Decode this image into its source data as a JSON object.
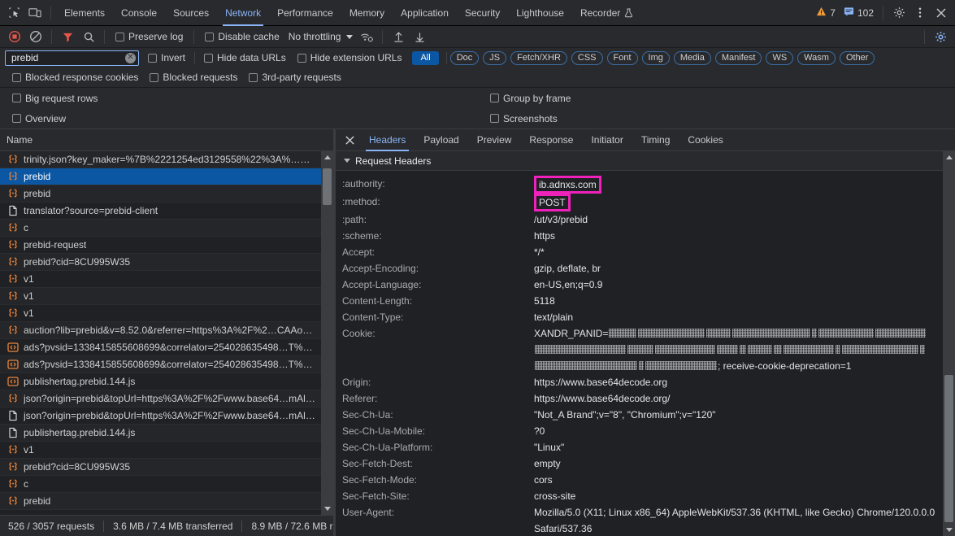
{
  "window": {
    "devtools_tabs": [
      {
        "label": "Elements",
        "active": false
      },
      {
        "label": "Console",
        "active": false
      },
      {
        "label": "Sources",
        "active": false
      },
      {
        "label": "Network",
        "active": true
      },
      {
        "label": "Performance",
        "active": false
      },
      {
        "label": "Memory",
        "active": false
      },
      {
        "label": "Application",
        "active": false
      },
      {
        "label": "Security",
        "active": false
      },
      {
        "label": "Lighthouse",
        "active": false
      },
      {
        "label": "Recorder",
        "active": false,
        "flask": true
      }
    ],
    "warnings_count": "7",
    "messages_count": "102"
  },
  "toolbar": {
    "throttling_label": "No throttling",
    "record_title": "Record",
    "clear_title": "Clear",
    "filter_title": "Filter",
    "search_title": "Search",
    "preserve_log": {
      "label": "Preserve log",
      "checked": false
    },
    "disable_cache": {
      "label": "Disable cache",
      "checked": false
    }
  },
  "filters": {
    "text_value": "prebid",
    "text_placeholder": "Filter",
    "invert": {
      "label": "Invert",
      "checked": false
    },
    "hide_data_urls": {
      "label": "Hide data URLs",
      "checked": false
    },
    "hide_extension_urls": {
      "label": "Hide extension URLs",
      "checked": false
    },
    "types": [
      {
        "label": "All",
        "selected": true
      },
      {
        "label": "Doc",
        "selected": false
      },
      {
        "label": "JS",
        "selected": false
      },
      {
        "label": "Fetch/XHR",
        "selected": false
      },
      {
        "label": "CSS",
        "selected": false
      },
      {
        "label": "Font",
        "selected": false
      },
      {
        "label": "Img",
        "selected": false
      },
      {
        "label": "Media",
        "selected": false
      },
      {
        "label": "Manifest",
        "selected": false
      },
      {
        "label": "WS",
        "selected": false
      },
      {
        "label": "Wasm",
        "selected": false
      },
      {
        "label": "Other",
        "selected": false
      }
    ],
    "blocked_response_cookies": {
      "label": "Blocked response cookies",
      "checked": false
    },
    "blocked_requests": {
      "label": "Blocked requests",
      "checked": false
    },
    "third_party_requests": {
      "label": "3rd-party requests",
      "checked": false
    }
  },
  "options": {
    "big_request_rows": {
      "label": "Big request rows",
      "checked": false
    },
    "group_by_frame": {
      "label": "Group by frame",
      "checked": false
    },
    "overview": {
      "label": "Overview",
      "checked": false
    },
    "screenshots": {
      "label": "Screenshots",
      "checked": false
    }
  },
  "request_list": {
    "column_header": "Name",
    "rows": [
      {
        "name": "trinity.json?key_maker=%7B%2221254ed3129558%22%3A%…%…",
        "icon": "json-icon",
        "selected": false
      },
      {
        "name": "prebid",
        "icon": "json-icon",
        "selected": true
      },
      {
        "name": "prebid",
        "icon": "json-icon",
        "selected": false
      },
      {
        "name": "translator?source=prebid-client",
        "icon": "document-icon",
        "selected": false
      },
      {
        "name": "c",
        "icon": "json-icon",
        "selected": false
      },
      {
        "name": "prebid-request",
        "icon": "json-icon",
        "selected": false
      },
      {
        "name": "prebid?cid=8CU995W35",
        "icon": "json-icon",
        "selected": false
      },
      {
        "name": "v1",
        "icon": "json-icon",
        "selected": false
      },
      {
        "name": "v1",
        "icon": "json-icon",
        "selected": false
      },
      {
        "name": "v1",
        "icon": "json-icon",
        "selected": false
      },
      {
        "name": "auction?lib=prebid&v=8.52.0&referrer=https%3A%2F%2…CAAoR…",
        "icon": "json-icon",
        "selected": false
      },
      {
        "name": "ads?pvsid=1338415855608699&correlator=254028635498…T%3…",
        "icon": "script-icon",
        "selected": false
      },
      {
        "name": "ads?pvsid=1338415855608699&correlator=254028635498…T%3…",
        "icon": "script-icon",
        "selected": false
      },
      {
        "name": "publishertag.prebid.144.js",
        "icon": "script-icon",
        "selected": false
      },
      {
        "name": "json?origin=prebid&topUrl=https%3A%2F%2Fwww.base64…mAll…",
        "icon": "json-icon",
        "selected": false
      },
      {
        "name": "json?origin=prebid&topUrl=https%3A%2F%2Fwww.base64…mAll…",
        "icon": "document-icon",
        "selected": false
      },
      {
        "name": "publishertag.prebid.144.js",
        "icon": "document-icon",
        "selected": false
      },
      {
        "name": "v1",
        "icon": "json-icon",
        "selected": false
      },
      {
        "name": "prebid?cid=8CU995W35",
        "icon": "json-icon",
        "selected": false
      },
      {
        "name": "c",
        "icon": "json-icon",
        "selected": false
      },
      {
        "name": "prebid",
        "icon": "json-icon",
        "selected": false
      }
    ]
  },
  "status_bar": {
    "requests": "526 / 3057 requests",
    "transferred": "3.6 MB / 7.4 MB transferred",
    "resources": "8.9 MB / 72.6 MB r"
  },
  "details": {
    "tabs": [
      {
        "label": "Headers",
        "active": true
      },
      {
        "label": "Payload",
        "active": false
      },
      {
        "label": "Preview",
        "active": false
      },
      {
        "label": "Response",
        "active": false
      },
      {
        "label": "Initiator",
        "active": false
      },
      {
        "label": "Timing",
        "active": false
      },
      {
        "label": "Cookies",
        "active": false
      }
    ],
    "section_title": "Request Headers",
    "headers": [
      {
        "name": ":authority:",
        "value": "ib.adnxs.com",
        "highlight": true
      },
      {
        "name": ":method:",
        "value": "POST",
        "highlight": true
      },
      {
        "name": ":path:",
        "value": "/ut/v3/prebid",
        "highlight": false
      },
      {
        "name": ":scheme:",
        "value": "https",
        "highlight": false
      },
      {
        "name": "Accept:",
        "value": "*/*",
        "highlight": false
      },
      {
        "name": "Accept-Encoding:",
        "value": "gzip, deflate, br",
        "highlight": false
      },
      {
        "name": "Accept-Language:",
        "value": "en-US,en;q=0.9",
        "highlight": false
      },
      {
        "name": "Content-Length:",
        "value": "5118",
        "highlight": false
      },
      {
        "name": "Content-Type:",
        "value": "text/plain",
        "highlight": false
      },
      {
        "name": "Cookie:",
        "value": "XANDR_PANID=",
        "redacted": true,
        "value_suffix": "; receive-cookie-deprecation=1",
        "highlight": false
      },
      {
        "name": "Origin:",
        "value": "https://www.base64decode.org",
        "highlight": false
      },
      {
        "name": "Referer:",
        "value": "https://www.base64decode.org/",
        "highlight": false
      },
      {
        "name": "Sec-Ch-Ua:",
        "value": "\"Not_A Brand\";v=\"8\", \"Chromium\";v=\"120\"",
        "highlight": false
      },
      {
        "name": "Sec-Ch-Ua-Mobile:",
        "value": "?0",
        "highlight": false
      },
      {
        "name": "Sec-Ch-Ua-Platform:",
        "value": "\"Linux\"",
        "highlight": false
      },
      {
        "name": "Sec-Fetch-Dest:",
        "value": "empty",
        "highlight": false
      },
      {
        "name": "Sec-Fetch-Mode:",
        "value": "cors",
        "highlight": false
      },
      {
        "name": "Sec-Fetch-Site:",
        "value": "cross-site",
        "highlight": false
      },
      {
        "name": "User-Agent:",
        "value": "Mozilla/5.0 (X11; Linux x86_64) AppleWebKit/537.36 (KHTML, like Gecko) Chrome/120.0.0.0 Safari/537.36",
        "highlight": false
      }
    ]
  },
  "colors": {
    "accent": "#8ab4f8",
    "selection": "#0b57a4",
    "highlight_box": "#ee22bb",
    "record_active": "#e4564a",
    "filter_active": "#e4564a",
    "warning": "#f29c38",
    "info": "#8ab4f8"
  }
}
